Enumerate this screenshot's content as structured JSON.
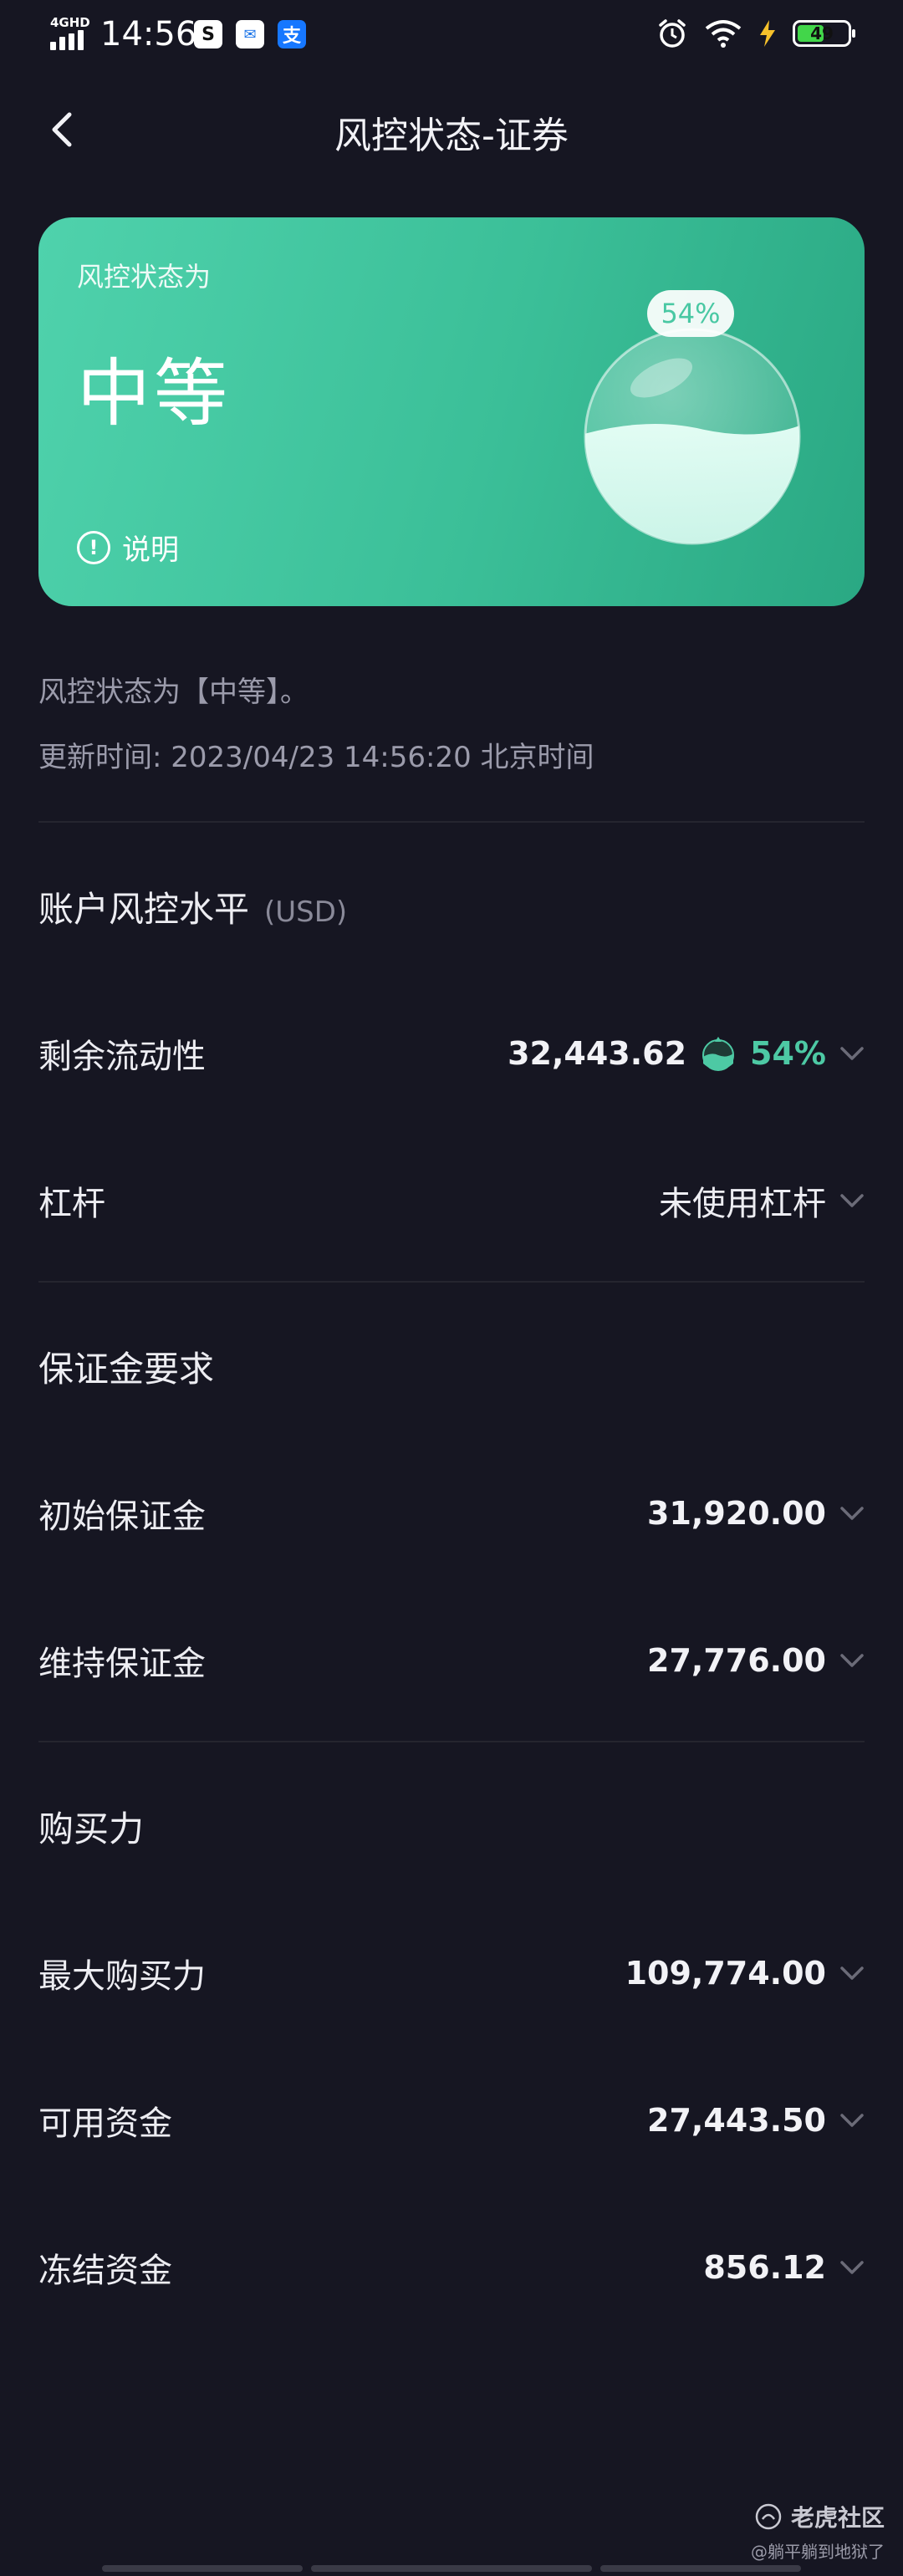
{
  "status_bar": {
    "network": "4GHD",
    "time": "14:56",
    "battery": "49"
  },
  "nav": {
    "title": "风控状态-证券"
  },
  "card": {
    "subtitle": "风控状态为",
    "level": "中等",
    "explain_label": "说明",
    "liquidity_percent_label": "54%",
    "liquidity_fraction": 0.54,
    "colors": {
      "start": "#4fd2ac",
      "end": "#2aa883"
    }
  },
  "info": {
    "status_line": "风控状态为【中等】。",
    "update_time": "更新时间: 2023/04/23 14:56:20 北京时间"
  },
  "account_risk": {
    "title": "账户风控水平",
    "unit": "(USD)",
    "liquidity": {
      "label": "剩余流动性",
      "value": "32,443.62",
      "percent": "54%"
    },
    "leverage": {
      "label": "杠杆",
      "value": "未使用杠杆"
    }
  },
  "margin": {
    "title": "保证金要求",
    "initial": {
      "label": "初始保证金",
      "value": "31,920.00"
    },
    "maintenance": {
      "label": "维持保证金",
      "value": "27,776.00"
    }
  },
  "buying_power": {
    "title": "购买力",
    "max": {
      "label": "最大购买力",
      "value": "109,774.00"
    },
    "available": {
      "label": "可用资金",
      "value": "27,443.50"
    },
    "frozen": {
      "label": "冻结资金",
      "value": "856.12"
    }
  },
  "watermark": {
    "brand": "老虎社区",
    "user": "@躺平躺到地狱了"
  }
}
